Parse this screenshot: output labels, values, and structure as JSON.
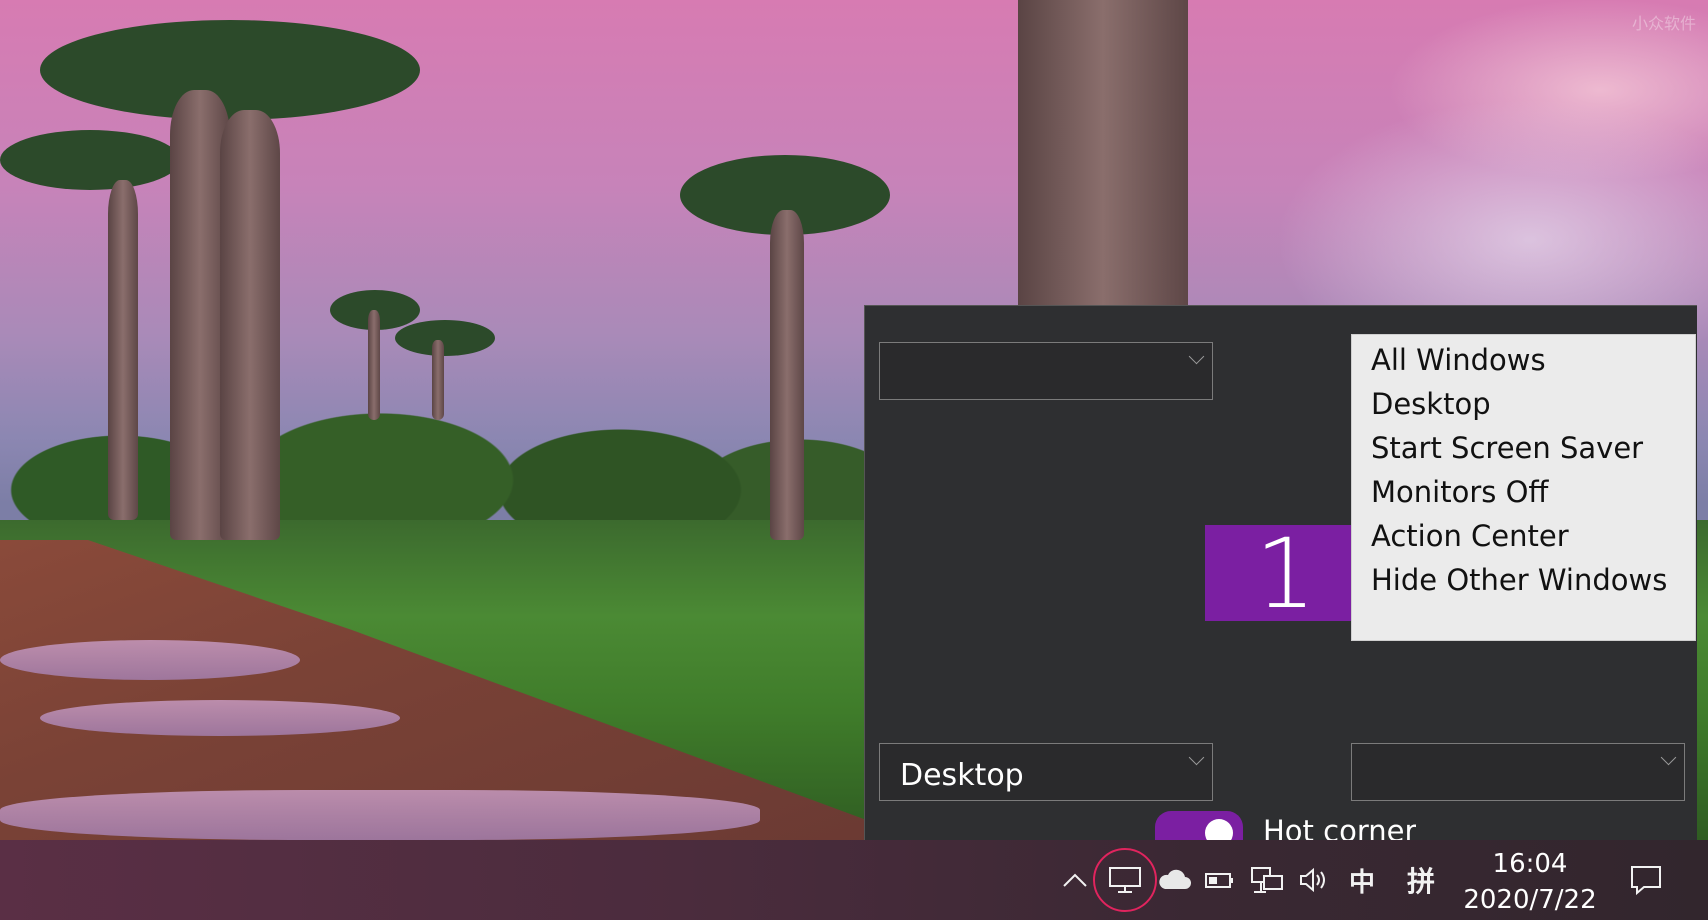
{
  "watermark": "小众软件",
  "panel": {
    "top_left_select": "",
    "bottom_left_select": "Desktop",
    "bottom_right_select": "",
    "monitor_number": "1",
    "menu_items": [
      "All Windows",
      "Desktop",
      "Start Screen Saver",
      "Monitors Off",
      "Action Center",
      "Hide Other Windows"
    ],
    "toggle_on": true,
    "toggle_label": "Hot corner",
    "accent_color": "#7b1fa2"
  },
  "taskbar": {
    "icons": [
      "chevron-up-icon",
      "display-icon",
      "onedrive-cloud-icon",
      "battery-icon",
      "network-icon",
      "volume-icon"
    ],
    "ime_mode": "中",
    "ime_name": "拼",
    "time": "16:04",
    "date": "2020/7/22",
    "highlight_color": "#e0245e"
  }
}
